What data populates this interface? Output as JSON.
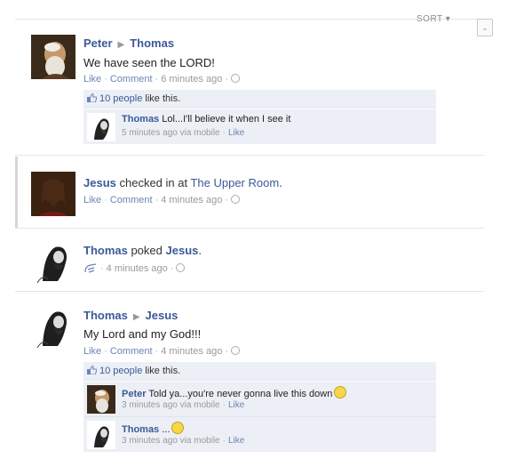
{
  "header": {
    "sort_label": "SORT ▾",
    "sort_button": "⌄"
  },
  "stories": [
    {
      "actor": "Peter",
      "target": "Thomas",
      "message": "We have seen the LORD!",
      "actions": {
        "like": "Like",
        "comment": "Comment",
        "time": "6 minutes ago"
      },
      "likes_text": "10 people",
      "likes_suffix": " like this.",
      "comments": [
        {
          "author": "Thomas",
          "text": " Lol...I'll believe it when I see it",
          "time": "5 minutes ago via mobile",
          "like": "Like"
        }
      ]
    },
    {
      "actor": "Jesus",
      "checkin_text": " checked in at ",
      "place": "The Upper Room",
      "place_suffix": ".",
      "actions": {
        "like": "Like",
        "comment": "Comment",
        "time": "4 minutes ago"
      }
    },
    {
      "actor": "Thomas",
      "poke_text": " poked ",
      "target": "Jesus",
      "poke_suffix": ".",
      "actions": {
        "time": "4 minutes ago"
      }
    },
    {
      "actor": "Thomas",
      "target": "Jesus",
      "message": "My Lord and my God!!!",
      "actions": {
        "like": "Like",
        "comment": "Comment",
        "time": "4 minutes ago"
      },
      "likes_text": "10 people",
      "likes_suffix": " like this.",
      "comments": [
        {
          "author": "Peter",
          "text": " Told ya...you're never gonna live this down",
          "time": "3 minutes ago via mobile",
          "like": "Like"
        },
        {
          "author": "Thomas",
          "text": " ...",
          "time": "3 minutes ago via mobile",
          "like": "Like"
        }
      ]
    }
  ],
  "colors": {
    "link": "#3b5998",
    "ufi_bg": "#eceff5",
    "meta": "#999999"
  }
}
